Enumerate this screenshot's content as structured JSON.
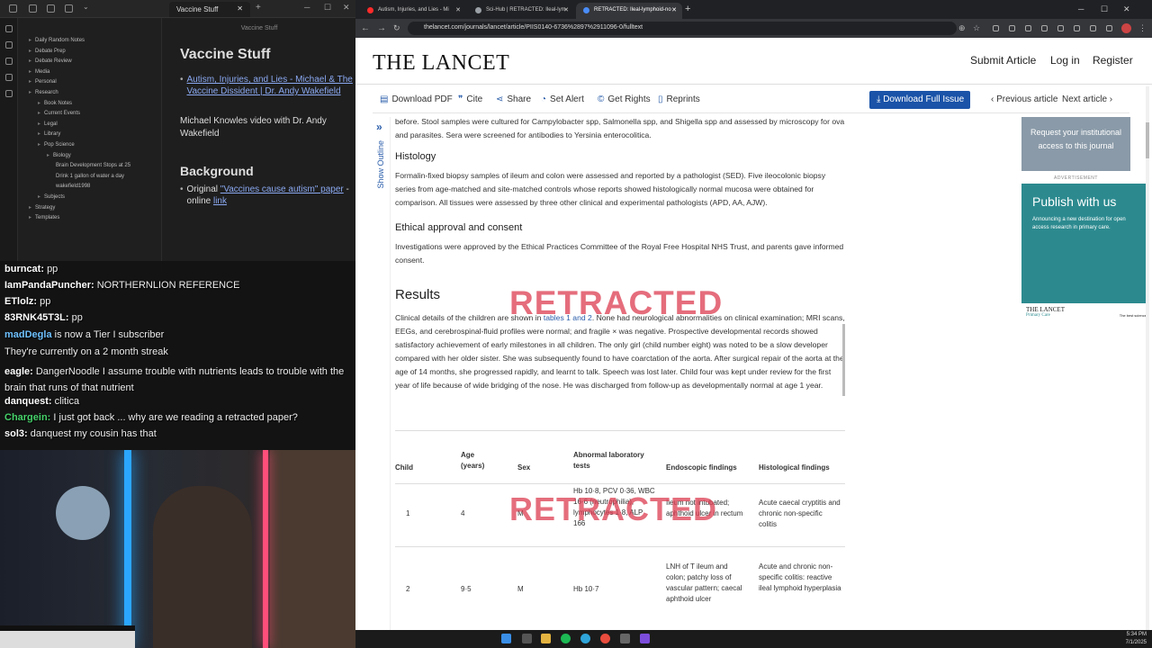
{
  "obsidian": {
    "tab_title": "Vaccine Stuff",
    "note_header_title": "Vaccine Stuff",
    "tree": [
      {
        "label": "Daily Random Notes",
        "indent": 0
      },
      {
        "label": "Debate Prep",
        "indent": 0
      },
      {
        "label": "Debate Review",
        "indent": 0
      },
      {
        "label": "Media",
        "indent": 0
      },
      {
        "label": "Personal",
        "indent": 0
      },
      {
        "label": "Research",
        "indent": 0
      },
      {
        "label": "Book Notes",
        "indent": 1
      },
      {
        "label": "Current Events",
        "indent": 1
      },
      {
        "label": "Legal",
        "indent": 1
      },
      {
        "label": "Library",
        "indent": 1
      },
      {
        "label": "Pop Science",
        "indent": 1
      },
      {
        "label": "Biology",
        "indent": 2
      },
      {
        "label": "Brain Development Stops at 25",
        "indent": 3
      },
      {
        "label": "Drink 1 gallon of water a day",
        "indent": 3
      },
      {
        "label": "wakefield1998",
        "indent": 3
      },
      {
        "label": "Subjects",
        "indent": 1
      },
      {
        "label": "Strategy",
        "indent": 0
      },
      {
        "label": "Templates",
        "indent": 0
      }
    ],
    "note": {
      "title": "Vaccine Stuff",
      "link1": "Autism, Injuries, and Lies - Michael & The Vaccine Dissident | Dr. Andy Wakefield",
      "text1": "Michael Knowles video with Dr. Andy Wakefield",
      "heading2": "Background",
      "item_prefix": "Original",
      "link2": "\"Vaccines cause autism\" paper",
      "item_mid": " - online ",
      "link3": "link"
    }
  },
  "chat": [
    {
      "user": "burncat:",
      "msg": "pp",
      "color": "#ffffff"
    },
    {
      "user": "IamPandaPuncher:",
      "msg": "NORTHERNLION REFERENCE",
      "color": "#ffffff"
    },
    {
      "user": "ETlolz:",
      "msg": "pp",
      "color": "#ffffff"
    },
    {
      "user": "83RNK45T3L:",
      "msg": "pp",
      "color": "#ffffff"
    },
    {
      "user": "madDegla",
      "msg": "is now a Tier I subscriber",
      "color": "#6ec1ff"
    },
    {
      "user": "",
      "msg": "They're currently on a 2 month streak",
      "color": "#ffffff"
    },
    {
      "user": "eagle:",
      "msg": "DangerNoodle I assume trouble with nutrients leads to trouble with the brain that runs of that nutrient",
      "color": "#ffffff"
    },
    {
      "user": "danquest:",
      "msg": "clitica",
      "color": "#ffffff"
    },
    {
      "user": "Chargein:",
      "msg": "I just got back ... why are we reading a retracted paper?",
      "color": "#46d16a"
    },
    {
      "user": "sol3:",
      "msg": "danquest my cousin has that",
      "color": "#ffffff"
    }
  ],
  "browser": {
    "tabs": [
      {
        "label": "Autism, Injuries, and Lies - Mi",
        "icon_color": "#ff2b2b",
        "active": false
      },
      {
        "label": "Sci-Hub | RETRACTED: Ileal-lym",
        "icon_color": "#9aa0a6",
        "active": false
      },
      {
        "label": "RETRACTED: Ileal-lymphoid-no",
        "icon_color": "#4a8cf7",
        "active": true
      }
    ],
    "url": "thelancet.com/journals/lancet/article/PIIS0140-6736%2897%2911096-0/fulltext"
  },
  "lancet": {
    "logo": "THE LANCET",
    "nav": [
      "Submit Article",
      "Log in",
      "Register"
    ],
    "toolbar": [
      "Download PDF",
      "Cite",
      "Share",
      "Set Alert",
      "Get Rights",
      "Reprints"
    ],
    "download_issue": "Download Full Issue",
    "prev_article": "Previous article",
    "next_article": "Next article",
    "outline_label": "Show Outline",
    "watermark": "RETRACTED",
    "article": {
      "p0": "before. Stool samples were cultured for Campylobacter spp, Salmonella spp, and Shigella spp and assessed by microscopy for ova and parasites. Sera were screened for antibodies to Yersinia enterocolitica.",
      "h_hist": "Histology",
      "p_hist": "Formalin-fixed biopsy samples of ileum and colon were assessed and reported by a pathologist (SED). Five ileocolonic biopsy series from age-matched and site-matched controls whose reports showed histologically normal mucosa were obtained for comparison. All tissues were assessed by three other clinical and experimental pathologists (APD, AA, AJW).",
      "h_eth": "Ethical approval and consent",
      "p_eth": "Investigations were approved by the Ethical Practices Committee of the Royal Free Hospital NHS Trust, and parents gave informed consent.",
      "h_res": "Results",
      "p_res_a": "Clinical details of the children are shown in ",
      "p_res_link": "tables 1 and 2",
      "p_res_b": ". None had neurological abnormalities on clinical examination; MRI scans, EEGs, and cerebrospinal-fluid profiles were normal; and fragile × was negative. Prospective developmental records showed satisfactory achievement of early milestones in all children. The only girl (child number eight) was noted to be a slow developer compared with her older sister. She was subsequently found to have coarctation of the aorta. After surgical repair of the aorta at the age of 14 months, she progressed rapidly, and learnt to talk. Speech was lost later. Child four was kept under review for the first year of life because of wide bridging of the nose. He was discharged from follow-up as developmentally normal at age 1 year."
    },
    "table": {
      "headers": [
        "Child",
        "Age (years)",
        "Sex",
        "Abnormal laboratory tests",
        "Endoscopic findings",
        "Histological findings"
      ],
      "rows": [
        [
          "1",
          "4",
          "M",
          "Hb 10·8, PCV 0·36, WBC 16·6 (neutrophilia), lymphocytes 1·8, ALP 166",
          "Ileum not intubated; aphthoid ulcer in rectum",
          "Acute caecal cryptitis and chronic non-specific colitis"
        ],
        [
          "2",
          "9·5",
          "M",
          "Hb 10·7",
          "LNH of T ileum and colon; patchy loss of vascular pattern; caecal aphthoid ulcer",
          "Acute and chronic non-specific colitis: reactive ileal lymphoid hyperplasia"
        ]
      ]
    },
    "sidebar": {
      "access": "Request your institutional access to this journal",
      "ad_label": "ADVERTISEMENT",
      "ad_title": "Publish with us",
      "ad_sub": "Announcing a new destination for open access research in primary care.",
      "ad_brand": "THE LANCET",
      "ad_brand_sub": "Primary Care",
      "ad_tag": "The best science"
    }
  },
  "taskbar": {
    "time": "5:34 PM",
    "date": "7/1/2025"
  }
}
